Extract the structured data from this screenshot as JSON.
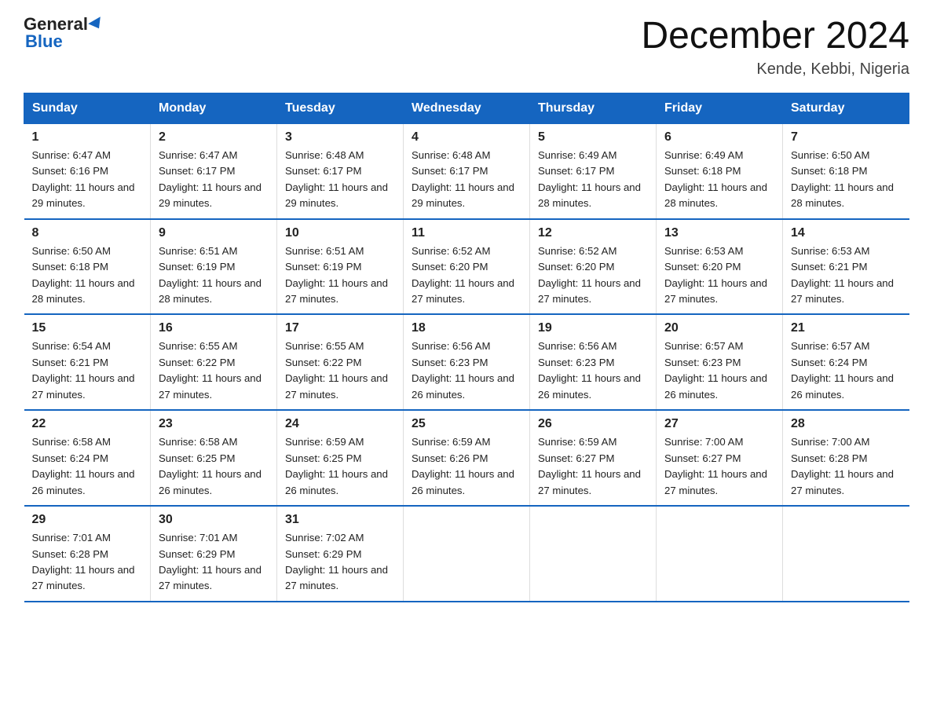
{
  "header": {
    "logo_general": "General",
    "logo_blue": "Blue",
    "title": "December 2024",
    "subtitle": "Kende, Kebbi, Nigeria"
  },
  "calendar": {
    "weekdays": [
      "Sunday",
      "Monday",
      "Tuesday",
      "Wednesday",
      "Thursday",
      "Friday",
      "Saturday"
    ],
    "weeks": [
      [
        {
          "day": "1",
          "sunrise": "6:47 AM",
          "sunset": "6:16 PM",
          "daylight": "11 hours and 29 minutes."
        },
        {
          "day": "2",
          "sunrise": "6:47 AM",
          "sunset": "6:17 PM",
          "daylight": "11 hours and 29 minutes."
        },
        {
          "day": "3",
          "sunrise": "6:48 AM",
          "sunset": "6:17 PM",
          "daylight": "11 hours and 29 minutes."
        },
        {
          "day": "4",
          "sunrise": "6:48 AM",
          "sunset": "6:17 PM",
          "daylight": "11 hours and 29 minutes."
        },
        {
          "day": "5",
          "sunrise": "6:49 AM",
          "sunset": "6:17 PM",
          "daylight": "11 hours and 28 minutes."
        },
        {
          "day": "6",
          "sunrise": "6:49 AM",
          "sunset": "6:18 PM",
          "daylight": "11 hours and 28 minutes."
        },
        {
          "day": "7",
          "sunrise": "6:50 AM",
          "sunset": "6:18 PM",
          "daylight": "11 hours and 28 minutes."
        }
      ],
      [
        {
          "day": "8",
          "sunrise": "6:50 AM",
          "sunset": "6:18 PM",
          "daylight": "11 hours and 28 minutes."
        },
        {
          "day": "9",
          "sunrise": "6:51 AM",
          "sunset": "6:19 PM",
          "daylight": "11 hours and 28 minutes."
        },
        {
          "day": "10",
          "sunrise": "6:51 AM",
          "sunset": "6:19 PM",
          "daylight": "11 hours and 27 minutes."
        },
        {
          "day": "11",
          "sunrise": "6:52 AM",
          "sunset": "6:20 PM",
          "daylight": "11 hours and 27 minutes."
        },
        {
          "day": "12",
          "sunrise": "6:52 AM",
          "sunset": "6:20 PM",
          "daylight": "11 hours and 27 minutes."
        },
        {
          "day": "13",
          "sunrise": "6:53 AM",
          "sunset": "6:20 PM",
          "daylight": "11 hours and 27 minutes."
        },
        {
          "day": "14",
          "sunrise": "6:53 AM",
          "sunset": "6:21 PM",
          "daylight": "11 hours and 27 minutes."
        }
      ],
      [
        {
          "day": "15",
          "sunrise": "6:54 AM",
          "sunset": "6:21 PM",
          "daylight": "11 hours and 27 minutes."
        },
        {
          "day": "16",
          "sunrise": "6:55 AM",
          "sunset": "6:22 PM",
          "daylight": "11 hours and 27 minutes."
        },
        {
          "day": "17",
          "sunrise": "6:55 AM",
          "sunset": "6:22 PM",
          "daylight": "11 hours and 27 minutes."
        },
        {
          "day": "18",
          "sunrise": "6:56 AM",
          "sunset": "6:23 PM",
          "daylight": "11 hours and 26 minutes."
        },
        {
          "day": "19",
          "sunrise": "6:56 AM",
          "sunset": "6:23 PM",
          "daylight": "11 hours and 26 minutes."
        },
        {
          "day": "20",
          "sunrise": "6:57 AM",
          "sunset": "6:23 PM",
          "daylight": "11 hours and 26 minutes."
        },
        {
          "day": "21",
          "sunrise": "6:57 AM",
          "sunset": "6:24 PM",
          "daylight": "11 hours and 26 minutes."
        }
      ],
      [
        {
          "day": "22",
          "sunrise": "6:58 AM",
          "sunset": "6:24 PM",
          "daylight": "11 hours and 26 minutes."
        },
        {
          "day": "23",
          "sunrise": "6:58 AM",
          "sunset": "6:25 PM",
          "daylight": "11 hours and 26 minutes."
        },
        {
          "day": "24",
          "sunrise": "6:59 AM",
          "sunset": "6:25 PM",
          "daylight": "11 hours and 26 minutes."
        },
        {
          "day": "25",
          "sunrise": "6:59 AM",
          "sunset": "6:26 PM",
          "daylight": "11 hours and 26 minutes."
        },
        {
          "day": "26",
          "sunrise": "6:59 AM",
          "sunset": "6:27 PM",
          "daylight": "11 hours and 27 minutes."
        },
        {
          "day": "27",
          "sunrise": "7:00 AM",
          "sunset": "6:27 PM",
          "daylight": "11 hours and 27 minutes."
        },
        {
          "day": "28",
          "sunrise": "7:00 AM",
          "sunset": "6:28 PM",
          "daylight": "11 hours and 27 minutes."
        }
      ],
      [
        {
          "day": "29",
          "sunrise": "7:01 AM",
          "sunset": "6:28 PM",
          "daylight": "11 hours and 27 minutes."
        },
        {
          "day": "30",
          "sunrise": "7:01 AM",
          "sunset": "6:29 PM",
          "daylight": "11 hours and 27 minutes."
        },
        {
          "day": "31",
          "sunrise": "7:02 AM",
          "sunset": "6:29 PM",
          "daylight": "11 hours and 27 minutes."
        },
        null,
        null,
        null,
        null
      ]
    ]
  }
}
